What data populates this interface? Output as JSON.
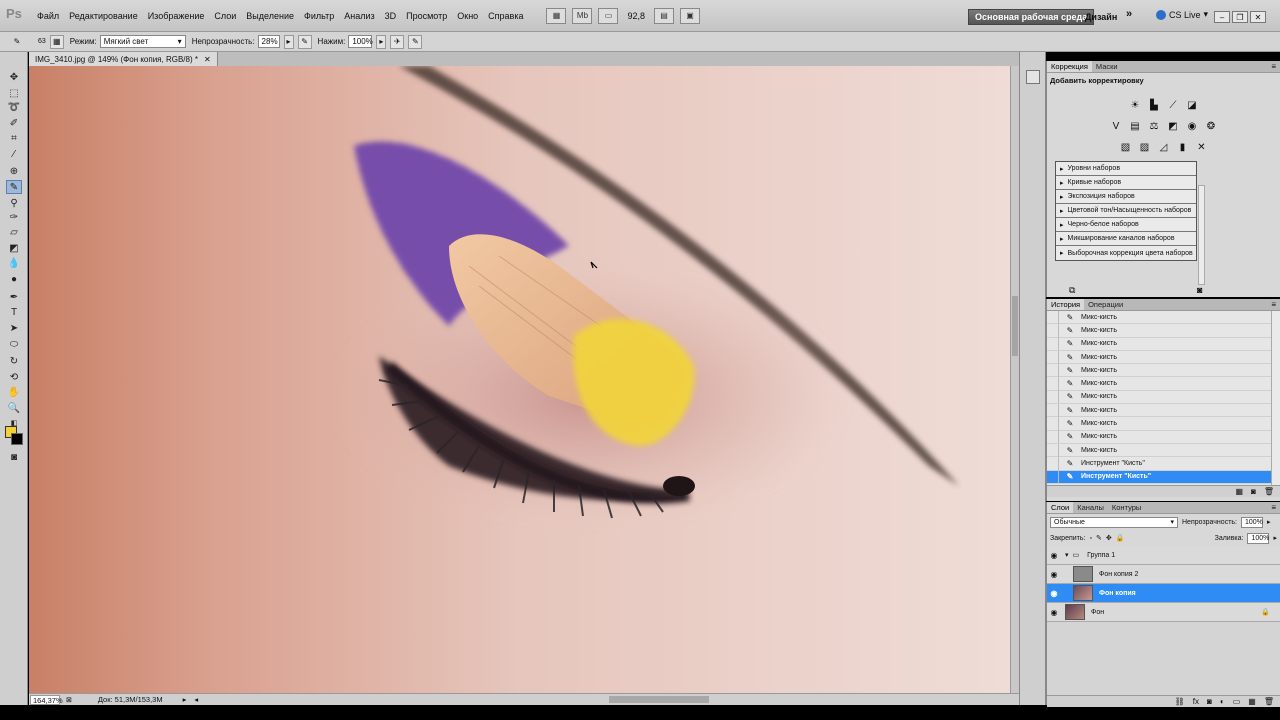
{
  "menubar": {
    "logo": "Ps",
    "items": [
      "Файл",
      "Редактирование",
      "Изображение",
      "Слои",
      "Выделение",
      "Фильтр",
      "Анализ",
      "3D",
      "Просмотр",
      "Окно",
      "Справка"
    ],
    "zoom": "92,8",
    "mb_label": "Mb",
    "workspace": "Основная рабочая среда",
    "design": "Дизайн",
    "cs_live": "CS Live"
  },
  "options": {
    "brush_size": "63",
    "mode_label": "Режим:",
    "mode_value": "Мягкий свет",
    "opacity_label": "Непрозрачность:",
    "opacity_value": "28%",
    "pressure_label": "Нажим:",
    "pressure_value": "100%"
  },
  "document": {
    "tab_title": "IMG_3410.jpg @ 149% (Фон копия, RGB/8) *",
    "status_zoom": "164,37%",
    "status_doc": "Док: 51,3M/153,3M"
  },
  "colors": {
    "foreground": "#f7d035",
    "background": "#000000",
    "selection": "#2f8cf5"
  },
  "correction_panel": {
    "tabs": [
      "Коррекция",
      "Маски"
    ],
    "title": "Добавить корректировку",
    "presets": [
      "Уровни наборов",
      "Кривые наборов",
      "Экспозиция наборов",
      "Цветовой тон/Насыщенность наборов",
      "Черно-белое наборов",
      "Микширование каналов наборов",
      "Выборочная коррекция цвета наборов"
    ]
  },
  "history_panel": {
    "tabs": [
      "История",
      "Операции"
    ],
    "items": [
      "Микс-кисть",
      "Микс-кисть",
      "Микс-кисть",
      "Микс-кисть",
      "Микс-кисть",
      "Микс-кисть",
      "Микс-кисть",
      "Микс-кисть",
      "Микс-кисть",
      "Микс-кисть",
      "Микс-кисть",
      "Инструмент \"Кисть\"",
      "Инструмент \"Кисть\""
    ]
  },
  "layers_panel": {
    "tabs": [
      "Слои",
      "Каналы",
      "Контуры"
    ],
    "blend_mode": "Обычные",
    "opacity_label": "Непрозрачность:",
    "opacity_value": "100%",
    "lock_label": "Закрепить:",
    "fill_label": "Заливка:",
    "fill_value": "100%",
    "layers": [
      "Группа 1",
      "Фон копия 2",
      "Фон копия",
      "Фон"
    ]
  }
}
